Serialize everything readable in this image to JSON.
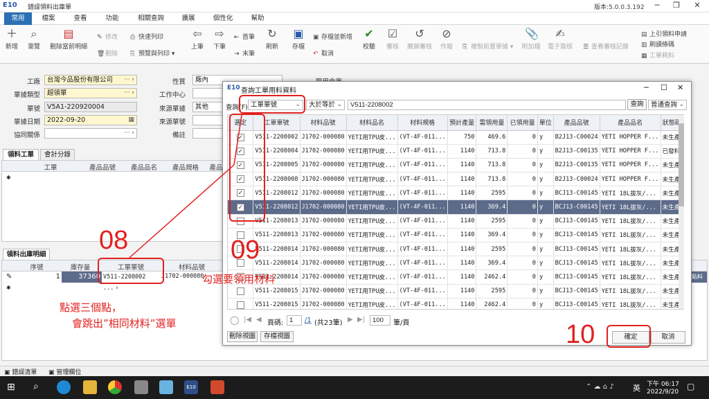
{
  "window": {
    "logo": "E10",
    "title": "錯誤領料出庫單",
    "version": "版本:5.0.0.3.192"
  },
  "menu": [
    "常用",
    "檔案",
    "查看",
    "功能",
    "相關查詢",
    "擴展",
    "個性化",
    "幫助"
  ],
  "ribbon": {
    "new": "新增",
    "view": "瀏覽",
    "delete_current_detail": "刪除當前明細",
    "modify": "修改",
    "remove": "刪除",
    "quick_print": "快速列印",
    "preview_print": "預覽與列印",
    "prev": "上筆",
    "next": "下筆",
    "first": "首筆",
    "last": "末筆",
    "refresh": "刷新",
    "save": "存檔",
    "save_and_new": "存檔並新增",
    "cancel": "取消",
    "check": "校驗",
    "approve": "審核",
    "unapprove": "撤銷審核",
    "void": "作廢",
    "copy_prev": "複製前置單據",
    "attach": "附加檔",
    "esign": "電子簽核",
    "view_approve_log": "查看審核記錄",
    "cite_request": "上引領料申請",
    "print_barcode": "刷讀條碼",
    "work_order_material": "工單耗料"
  },
  "form": {
    "factory_label": "工廠",
    "factory_value": "台灣今品股份有限公司",
    "doc_type_label": "單據類型",
    "doc_type_value": "超領單",
    "doc_no_label": "單號",
    "doc_no_value": "V5A1-220920004",
    "doc_date_label": "單據日期",
    "doc_date_value": "2022-09-20",
    "partner_label": "協同關係",
    "partner_value": "",
    "nature_label": "性質",
    "nature_value": "廠內",
    "work_center_label": "工作中心",
    "work_center_value": "",
    "source_type_label": "來源單據",
    "source_type_value": "其他",
    "source_no_label": "來源單號",
    "source_no_value": "",
    "remark_label": "備註",
    "remark_value": "",
    "limit_wh_label": "限用倉庫"
  },
  "upper_tabs": [
    "領料工單",
    "會計分錄"
  ],
  "upper_cols": [
    "工單",
    "產品品號",
    "產品品名",
    "產品規格",
    "產品"
  ],
  "lower_tab": "領料出庫明細",
  "lower_cols": [
    "序號",
    "庫存量",
    "工單單號",
    "材料品號"
  ],
  "lower_row": {
    "seq": "1",
    "stock": "37360",
    "wo": "V511-2208002 ...",
    "mat": "J1702-000080"
  },
  "lower_right_stub": "點料",
  "dialog": {
    "logo": "E10",
    "title": "查詢工單用料資料",
    "query_label": "查詢(F)",
    "field_select": "工單單號",
    "op_select": "大於等於",
    "query_value": "V511-2208002",
    "query_button": "查詢",
    "mode_select": "普通查詢",
    "columns": [
      "選定",
      "工單單號",
      "材料品號",
      "材料品名",
      "材料規格",
      "預計產量",
      "需領用量",
      "已領用量",
      "單位",
      "產品品號",
      "產品品名",
      "狀態碼"
    ],
    "rows": [
      {
        "checked": true,
        "wo": "V511-2208002",
        "mat": "J1702-000080",
        "name": "YETI用TPU皮...",
        "spec": "(VT-4F-011...",
        "plan": "750",
        "need": "469.6",
        "issued": "0",
        "unit": "y",
        "prod": "B2J13-C00024",
        "pname": "YETI HOPPER F...",
        "status": "未生產",
        "sel": false
      },
      {
        "checked": true,
        "wo": "V511-2208004",
        "mat": "J1702-000080",
        "name": "YETI用TPU皮...",
        "spec": "(VT-4F-011...",
        "plan": "1140",
        "need": "713.8",
        "issued": "0",
        "unit": "y",
        "prod": "B2J13-C00135",
        "pname": "YETI HOPPER F...",
        "status": "已發料",
        "sel": false
      },
      {
        "checked": true,
        "wo": "V511-2208005",
        "mat": "J1702-000080",
        "name": "YETI用TPU皮...",
        "spec": "(VT-4F-011...",
        "plan": "1140",
        "need": "713.8",
        "issued": "0",
        "unit": "y",
        "prod": "B2J13-C00135",
        "pname": "YETI HOPPER F...",
        "status": "未生產",
        "sel": false
      },
      {
        "checked": true,
        "wo": "V511-2208008",
        "mat": "J1702-000080",
        "name": "YETI用TPU皮...",
        "spec": "(VT-4F-011...",
        "plan": "1140",
        "need": "713.8",
        "issued": "0",
        "unit": "y",
        "prod": "B2J13-C00024",
        "pname": "YETI HOPPER F...",
        "status": "未生產",
        "sel": false
      },
      {
        "checked": true,
        "wo": "V511-2208012",
        "mat": "J1702-000080",
        "name": "YETI用TPU皮...",
        "spec": "(VT-4F-011...",
        "plan": "1140",
        "need": "2595",
        "issued": "0",
        "unit": "y",
        "prod": "BCJ13-C00145",
        "pname": "YETI 18L拔灰/...",
        "status": "未生產",
        "sel": false
      },
      {
        "checked": true,
        "wo": "V511-2208012",
        "mat": "J1702-000080",
        "name": "YETI用TPU皮...",
        "spec": "(VT-4F-011...",
        "plan": "1140",
        "need": "369.4",
        "issued": "0",
        "unit": "y",
        "prod": "BCJ13-C00145",
        "pname": "YETI 18L拔灰/...",
        "status": "未生產",
        "sel": true
      },
      {
        "checked": false,
        "wo": "V511-2208013",
        "mat": "J1702-000080",
        "name": "YETI用TPU皮...",
        "spec": "(VT-4F-011...",
        "plan": "1140",
        "need": "2595",
        "issued": "0",
        "unit": "y",
        "prod": "BCJ13-C00145",
        "pname": "YETI 18L拔灰/...",
        "status": "未生產",
        "sel": false
      },
      {
        "checked": false,
        "wo": "V511-2208013",
        "mat": "J1702-000080",
        "name": "YETI用TPU皮...",
        "spec": "(VT-4F-011...",
        "plan": "1140",
        "need": "369.4",
        "issued": "0",
        "unit": "y",
        "prod": "BCJ13-C00145",
        "pname": "YETI 18L拔灰/...",
        "status": "未生產",
        "sel": false
      },
      {
        "checked": false,
        "wo": "V511-2208014",
        "mat": "J1702-000080",
        "name": "YETI用TPU皮...",
        "spec": "(VT-4F-011...",
        "plan": "1140",
        "need": "2595",
        "issued": "0",
        "unit": "y",
        "prod": "BCJ13-C00145",
        "pname": "YETI 18L拔灰/...",
        "status": "未生產",
        "sel": false
      },
      {
        "checked": false,
        "wo": "V511-2208014",
        "mat": "J1702-000080",
        "name": "YETI用TPU皮...",
        "spec": "(VT-4F-011...",
        "plan": "1140",
        "need": "369.4",
        "issued": "0",
        "unit": "y",
        "prod": "BCJ13-C00145",
        "pname": "YETI 18L拔灰/...",
        "status": "未生產",
        "sel": false
      },
      {
        "checked": false,
        "wo": "V511-2208014",
        "mat": "J1702-000080",
        "name": "YETI用TPU皮...",
        "spec": "(VT-4F-011...",
        "plan": "1140",
        "need": "2462.4",
        "issued": "0",
        "unit": "y",
        "prod": "BCJ13-C00145",
        "pname": "YETI 18L拔灰/...",
        "status": "未生產",
        "sel": false
      },
      {
        "checked": false,
        "wo": "V511-2208015",
        "mat": "J1702-000080",
        "name": "YETI用TPU皮...",
        "spec": "(VT-4F-011...",
        "plan": "1140",
        "need": "2595",
        "issued": "0",
        "unit": "y",
        "prod": "BCJ13-C00145",
        "pname": "YETI 18L拔灰/...",
        "status": "未生產",
        "sel": false
      },
      {
        "checked": false,
        "wo": "V511-2208015",
        "mat": "J1702-000080",
        "name": "YETI用TPU皮...",
        "spec": "(VT-4F-011...",
        "plan": "1140",
        "need": "2462.4",
        "issued": "0",
        "unit": "y",
        "prod": "BCJ13-C00145",
        "pname": "YETI 18L拔灰/...",
        "status": "未生產",
        "sel": false
      }
    ],
    "pager": {
      "page_label": "頁碼:",
      "page": "1",
      "total_link": "/1",
      "total_text": "(共23筆)",
      "page_size": "100",
      "page_size_unit": "筆/頁"
    },
    "delete_view": "刪除視圖",
    "save_view": "存檔視圖",
    "ok": "確定",
    "cancel": "取消"
  },
  "annotations": {
    "step08": "08",
    "step09": "09",
    "step10": "10",
    "pick_text": "勾選要領用材料",
    "note_line1": "點選三個點，",
    "note_line2": "會跳出”相同材料”選單",
    "color": "#e02020"
  },
  "bottom_tabs": [
    "錯誤清單",
    "管理欄位"
  ],
  "taskbar": {
    "lang": "英",
    "time": "下午 06:17",
    "date": "2022/9/20"
  }
}
